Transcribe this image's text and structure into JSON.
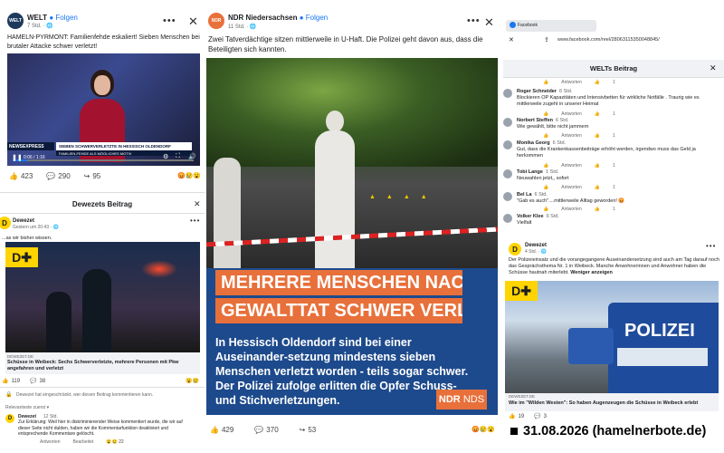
{
  "welt": {
    "name": "WELT",
    "follow": "Folgen",
    "time": "7 Std. · 🌐",
    "text": "HAMELN-PYRMONT: Familienfehde eskaliert! Sieben Menschen bei brutaler Attacke schwer verletzt!",
    "lower_third_1": "SIEBEN SCHWERVERLETZTE IN HESSISCH OLDENDORF",
    "lower_third_2": "FAMILIEN-FEHDE ALS MÖGLICHES MOTIV",
    "news_label": "NEWSEXPRESS",
    "video_time": "0:06 / 1:16",
    "likes": "423",
    "comments": "290",
    "shares": "95",
    "more": "•••",
    "close": "✕",
    "close_icon": "close-icon"
  },
  "dewezet_left": {
    "title": "Dewezets Beitrag",
    "name": "Dewezet",
    "time": "Gestern um 20:43 · 🌐",
    "text": "...as wir bisher wissen.",
    "link_domain": "DEWEZET.DE",
    "link_title": "Schüsse in Weibeck: Sechs Schwerverletzte, mehrere Personen mit Pkw angefahren und verletzt",
    "likes": "119",
    "comments": "38",
    "restricted": "Dewezet hat eingeschränkt, wer diesen Beitrag kommentieren kann.",
    "sort": "Relevanteste zuerst ▾",
    "comment_name": "Dewezet",
    "comment_time": "12 Std.",
    "comment_text": "Zur Erklärung: Weil hier in diskriminierender Weise kommentiert wurde, die wir auf dieser Seite nicht dulden, haben wir die Kommentarfunktion deaktiviert und entsprechende Kommentare gelöscht.",
    "comment_actions": [
      "Antworten",
      "Bearbeitet"
    ],
    "comment_count": "22",
    "logo": "D"
  },
  "ndr": {
    "name": "NDR Niedersachsen",
    "follow": "Folgen",
    "time": "11 Std. · 🌐",
    "text": "Zwei Tatverdächtige sitzen mittlerweile in U-Haft. Die Polizei geht davon aus, dass die Beteiligten sich kannten.",
    "headline_1": "MEHRERE MENSCHEN NACH",
    "headline_2": "GEWALTTAT SCHWER VERLETZT",
    "body": "In Hessisch Oldendorf sind bei einer Auseinander-setzung mindestens sieben Menschen verletzt worden - teils sogar schwer. Der Polizei zufolge erlitten die Opfer Schuss-und Stichverletzungen.",
    "logo": "NDR",
    "logo_sub": "NDS",
    "likes": "429",
    "comments": "370",
    "shares": "53",
    "avatar": "NDR",
    "more": "•••",
    "close": "✕"
  },
  "browser": {
    "tab": "Facebook",
    "url": "www.facebook.com/reel/28063115350048845/",
    "title": "WELTs Beitrag",
    "close": "✕"
  },
  "comments": [
    {
      "name": "",
      "time": "",
      "text": "",
      "actions": [
        "Antworten"
      ],
      "count": "1"
    },
    {
      "name": "Roger Schneider",
      "time": "6 Std.",
      "text": "Blockieren OP Kapazitäten und Intensivbetten für wirkliche Notfälle . Traurig wie es mittlerweile zugeht in unserer Heimat",
      "actions": [
        "Antworten"
      ],
      "count": "1"
    },
    {
      "name": "Norbert Steffen",
      "time": "6 Std.",
      "text": "Wie gewählt, bitte nicht jammern",
      "actions": [
        "Antworten"
      ],
      "count": "1"
    },
    {
      "name": "Monika Georg",
      "time": "6 Std.",
      "text": "Gut, dass die Krankenkassenbeiträge erhöht werden, irgendwo muss das Geld ja herkommen",
      "actions": [
        "Antworten"
      ],
      "count": "1"
    },
    {
      "name": "Tobi Lange",
      "time": "1 Std.",
      "text": "Neuwahlen jetzt,, sofort",
      "actions": [
        "Antworten"
      ],
      "count": "1"
    },
    {
      "name": "Bel La",
      "time": "6 Std.",
      "text": "\"Gab es auch\"....mittlerweile Alltag geworden! 😡",
      "actions": [
        "Antworten"
      ],
      "count": "1"
    },
    {
      "name": "Volker Klee",
      "time": "6 Std.",
      "text": "Vielfalt",
      "actions": [
        "Antworten"
      ],
      "count": "1"
    }
  ],
  "dewezet_right": {
    "name": "Dewezet",
    "time": "4 Std. · 🌐",
    "text": "Der Polizeieinsatz und die vorangegangene Auseinandersetzung sind auch am Tag darauf noch das Gesprächsthema Nr. 1 in Weibeck. Manche Anwohnerinnen und Anwohner haben die Schüsse hautnah miterlebt.",
    "more_link": "Weniger anzeigen",
    "police_text": "POLIZEI",
    "link_domain": "DEWEZET.DE",
    "link_title": "Wie im \"Wilden Westen\": So haben Augenzeugen die Schüsse in Weibeck erlebt",
    "likes": "19",
    "comments": "3",
    "logo": "D"
  },
  "watermark": "31.08.2026 (hamelnerbote.de)",
  "colors": {
    "fb_blue": "#1877f2",
    "ndr_orange": "#e8703a",
    "ndr_blue": "#1d4a8c",
    "dewezet_yellow": "#ffd400"
  }
}
